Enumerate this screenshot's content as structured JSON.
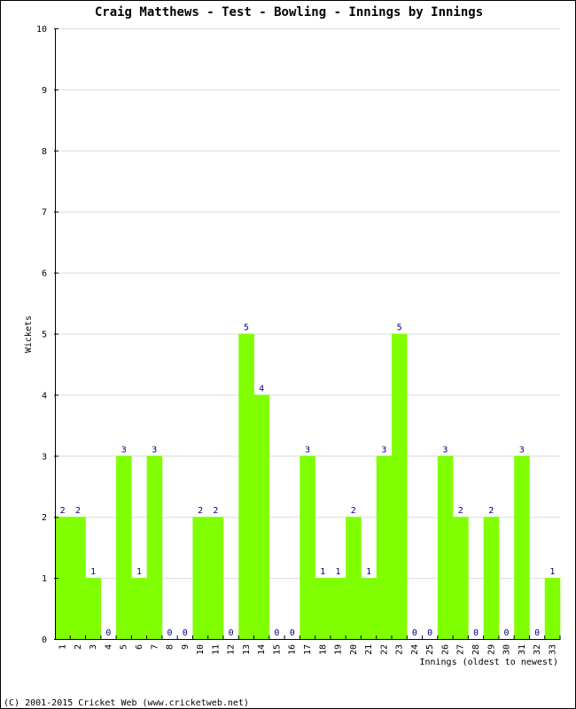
{
  "chart_data": {
    "type": "bar",
    "title": "Craig Matthews - Test - Bowling - Innings by Innings",
    "xlabel": "Innings (oldest to newest)",
    "ylabel": "Wickets",
    "ylim": [
      0,
      10
    ],
    "yticks": [
      "0",
      "1",
      "2",
      "3",
      "4",
      "5",
      "6",
      "7",
      "8",
      "9",
      "10"
    ],
    "grid": true,
    "bar_color": "#80ff00",
    "label_color": "#000080",
    "categories": [
      "1",
      "2",
      "3",
      "4",
      "5",
      "6",
      "7",
      "8",
      "9",
      "10",
      "11",
      "12",
      "13",
      "14",
      "15",
      "16",
      "17",
      "18",
      "19",
      "20",
      "21",
      "22",
      "23",
      "24",
      "25",
      "26",
      "27",
      "28",
      "29",
      "30",
      "31",
      "32",
      "33"
    ],
    "values": [
      2,
      2,
      1,
      0,
      3,
      1,
      3,
      0,
      0,
      2,
      2,
      0,
      5,
      4,
      0,
      0,
      3,
      1,
      1,
      2,
      1,
      3,
      5,
      0,
      0,
      3,
      2,
      0,
      2,
      0,
      3,
      0,
      1
    ]
  },
  "footer": "(C) 2001-2015 Cricket Web (www.cricketweb.net)"
}
